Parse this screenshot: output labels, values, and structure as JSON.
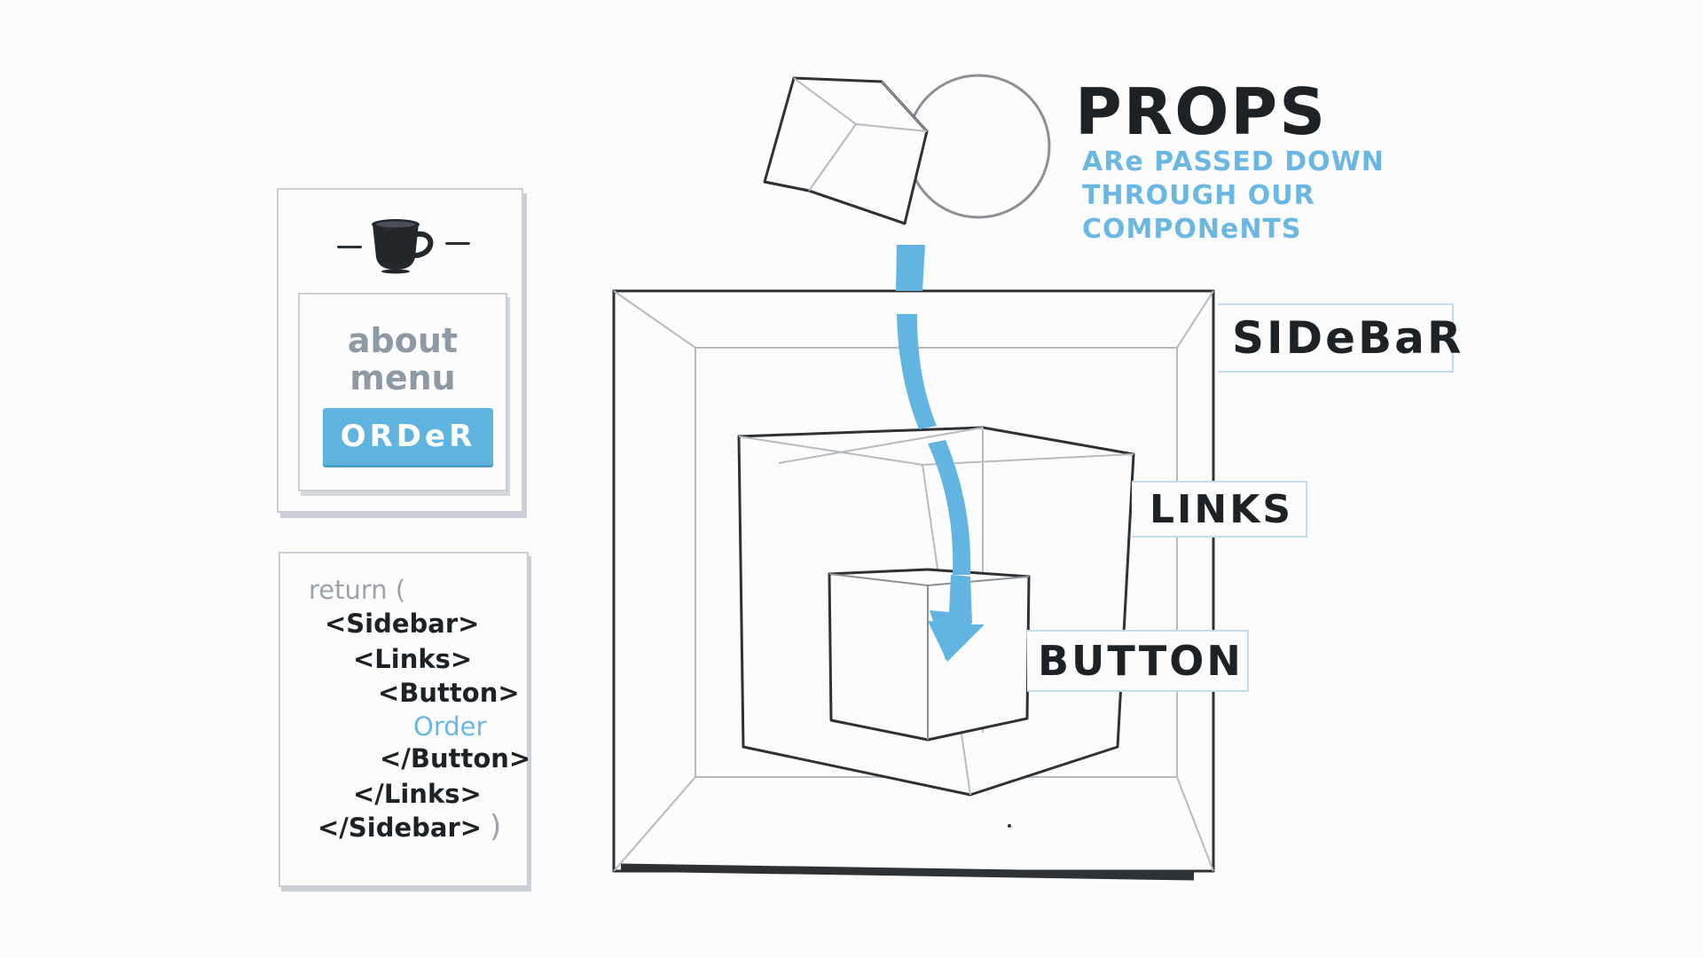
{
  "header": {
    "title": "PROPS",
    "subtitle_lines": [
      "ARe PASSED DOWN",
      "THROUGH OUR",
      "COMPONeNTS"
    ]
  },
  "labels": {
    "sidebar": "SIDeBaR",
    "links": "LINKS",
    "button": "BUTTON"
  },
  "mock_ui": {
    "icon": "coffee-cup-icon",
    "links": [
      "about",
      "menu"
    ],
    "order_button": "ORDeR"
  },
  "code": {
    "lines": [
      "return (",
      "<Sidebar>",
      "<Links>",
      "<Button>",
      "Order",
      "</Button>",
      "</Links>",
      "</Sidebar>",
      ")"
    ]
  },
  "colors": {
    "accent": "#6ab7e2",
    "ink": "#1d2226",
    "muted": "#8e99a6",
    "label_border": "#c3dcec"
  }
}
